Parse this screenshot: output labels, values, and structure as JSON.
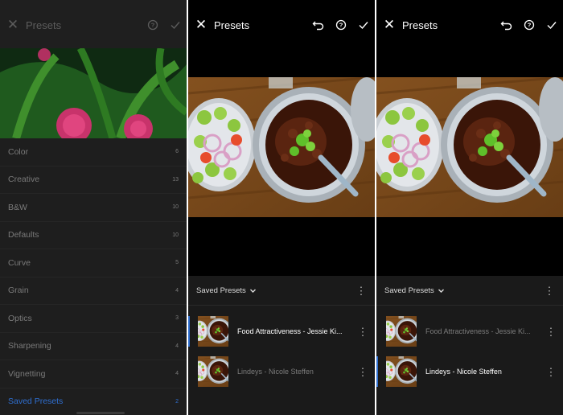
{
  "panel1": {
    "title": "Presets",
    "categories": [
      {
        "label": "Color",
        "count": "6"
      },
      {
        "label": "Creative",
        "count": "13"
      },
      {
        "label": "B&W",
        "count": "10"
      },
      {
        "label": "Defaults",
        "count": "10"
      },
      {
        "label": "Curve",
        "count": "5"
      },
      {
        "label": "Grain",
        "count": "4"
      },
      {
        "label": "Optics",
        "count": "3"
      },
      {
        "label": "Sharpening",
        "count": "4"
      },
      {
        "label": "Vignetting",
        "count": "4"
      },
      {
        "label": "Saved Presets",
        "count": "2"
      }
    ],
    "active_category": "Saved Presets"
  },
  "panel2": {
    "title": "Presets",
    "section_title": "Saved Presets",
    "presets": [
      {
        "name": "Food Attractiveness - Jessie Ki..."
      },
      {
        "name": "Lindeys - Nicole Steffen"
      }
    ],
    "selected_index": 0
  },
  "panel3": {
    "title": "Presets",
    "section_title": "Saved Presets",
    "presets": [
      {
        "name": "Food Attractiveness - Jessie Ki..."
      },
      {
        "name": "Lindeys - Nicole Steffen"
      }
    ],
    "selected_index": 1
  },
  "icons": {
    "close": "close-icon",
    "undo": "undo-icon",
    "help": "help-icon",
    "confirm": "checkmark-icon",
    "more": "more-vertical-icon",
    "dropdown": "chevron-down-icon"
  },
  "colors": {
    "accent": "#2f6fd0",
    "panel_bg": "#1c1c1c",
    "canvas_bg": "#000000"
  }
}
